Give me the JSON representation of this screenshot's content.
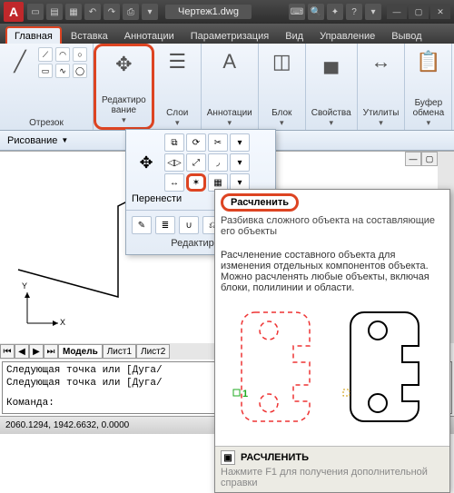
{
  "titlebar": {
    "app_badge": "A",
    "filename": "Чертеж1.dwg"
  },
  "tabs": {
    "home": "Главная",
    "insert": "Вставка",
    "annotate": "Аннотации",
    "parametric": "Параметризация",
    "view": "Вид",
    "manage": "Управление",
    "output": "Вывод"
  },
  "ribbon": {
    "segment": {
      "label": "Отрезок"
    },
    "edit": {
      "label": "Редактиро\nвание"
    },
    "layers": {
      "label": "Слои"
    },
    "annotations": {
      "label": "Аннотации",
      "glyph": "A"
    },
    "block": {
      "label": "Блок"
    },
    "properties": {
      "label": "Свойства"
    },
    "utilities": {
      "label": "Утилиты"
    },
    "clipboard": {
      "label": "Буфер\nобмена"
    },
    "draw_panel": "Рисование"
  },
  "float_edit": {
    "move": "Перенести",
    "panel_title": "Редактирова"
  },
  "tooltip": {
    "title": "Расчленить",
    "short": "Разбивка сложного объекта на составляющие его объекты",
    "long": "Расчленение составного объекта для изменения отдельных компонентов объекта. Можно расчленять любые объекты, включая блоки, полилинии и области.",
    "pick_label": "1",
    "cmd": "РАСЧЛЕНИТЬ",
    "f1": "Нажмите F1 для получения дополнительной справки"
  },
  "sheets": {
    "model": "Модель",
    "sheet1": "Лист1",
    "sheet2": "Лист2"
  },
  "cmd": {
    "line1": "Следующая точка или [Дуга/",
    "line2": "Следующая точка или [Дуга/",
    "prompt": "Команда:"
  },
  "status": {
    "coords": "2060.1294, 1942.6632, 0.0000"
  },
  "axes": {
    "x": "X",
    "y": "Y"
  }
}
